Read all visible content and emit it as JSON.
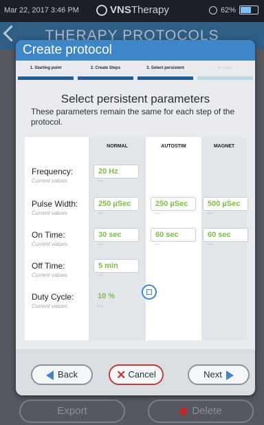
{
  "status_bar": {
    "time": "Mar 22, 2017 3:46 PM",
    "brand_bold": "VNS",
    "brand_thin": "Therapy",
    "battery": "62%",
    "battery_level": 0.62
  },
  "background": {
    "title": "THERAPY PROTOCOLS",
    "export_label": "Export",
    "delete_label": "Delete"
  },
  "modal": {
    "title": "Create protocol",
    "steps": [
      {
        "label": "1. Starting point",
        "state": "done"
      },
      {
        "label": "2. Create Steps",
        "state": "done"
      },
      {
        "label": "3. Select persistent",
        "state": "active"
      },
      {
        "label": "4. Save",
        "state": "inactive"
      }
    ],
    "heading": "Select persistent parameters",
    "subtext": "These parameters remain the same for each step of the protocol.",
    "columns": [
      "NORMAL",
      "AUTOSTIM",
      "MAGNET"
    ],
    "current_values_label": "Current values",
    "rows": [
      {
        "label": "Frequency:",
        "values": [
          "20 Hz",
          "",
          ""
        ],
        "current": [
          "---",
          "",
          ""
        ]
      },
      {
        "label": "Pulse Width:",
        "values": [
          "250 µSec",
          "250 µSec",
          "500 µSec"
        ],
        "current": [
          "---",
          "---",
          "---"
        ]
      },
      {
        "label": "On Time:",
        "values": [
          "30 sec",
          "60 sec",
          "60 sec"
        ],
        "current": [
          "---",
          "---",
          "---"
        ]
      },
      {
        "label": "Off Time:",
        "values": [
          "5 min",
          "",
          ""
        ],
        "current": [
          "---",
          "",
          ""
        ]
      },
      {
        "label": "Duty Cycle:",
        "values": [
          "10 %",
          "",
          ""
        ],
        "current": [
          "---",
          "",
          ""
        ]
      }
    ],
    "buttons": {
      "back": "Back",
      "cancel": "Cancel",
      "next": "Next"
    }
  },
  "colors": {
    "accent": "#3e86c7",
    "value_green": "#7bc043",
    "danger": "#c23a3a"
  }
}
